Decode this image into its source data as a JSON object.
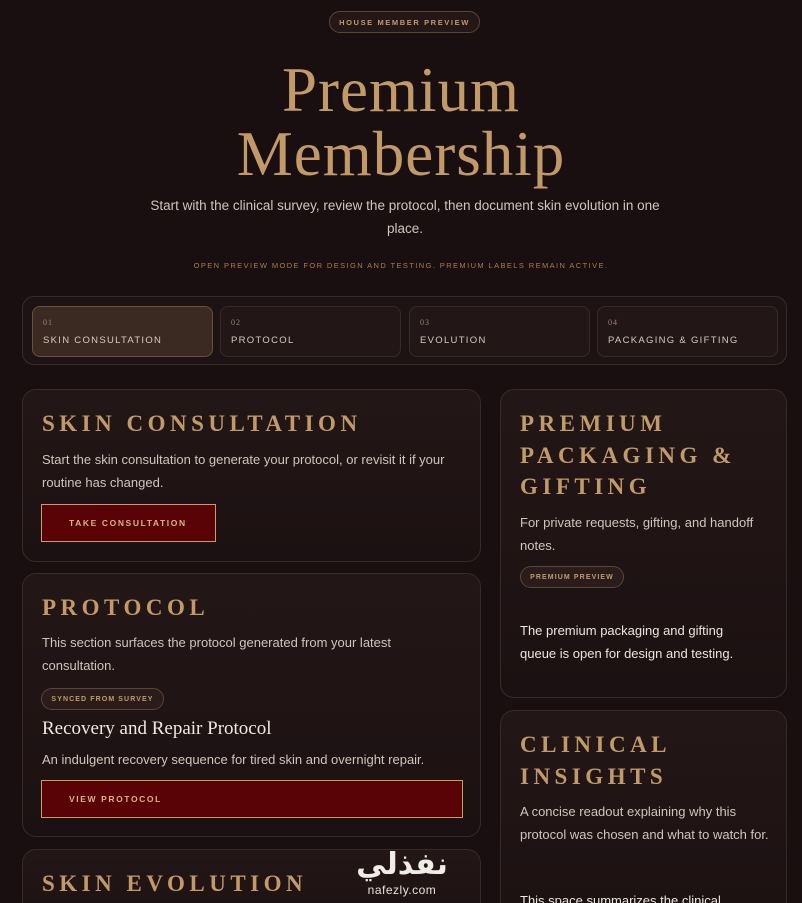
{
  "hero": {
    "badge": "HOUSE MEMBER PREVIEW",
    "title_line1": "Premium",
    "title_line2": "Membership",
    "subtitle": "Start with the clinical survey, review the protocol, then document skin evolution in one place.",
    "note": "OPEN PREVIEW MODE FOR DESIGN AND TESTING. PREMIUM LABELS REMAIN ACTIVE."
  },
  "steps": [
    {
      "num": "01",
      "label": "SKIN CONSULTATION",
      "active": true
    },
    {
      "num": "02",
      "label": "PROTOCOL",
      "active": false
    },
    {
      "num": "03",
      "label": "EVOLUTION",
      "active": false
    },
    {
      "num": "04",
      "label": "PACKAGING & GIFTING",
      "active": false
    }
  ],
  "consultation": {
    "title": "SKIN CONSULTATION",
    "body": "Start the skin consultation to generate your protocol, or revisit it if your routine has changed.",
    "button": "TAKE CONSULTATION"
  },
  "protocol": {
    "title": "PROTOCOL",
    "body": "This section surfaces the protocol generated from your latest consultation.",
    "tag": "SYNCED FROM SURVEY",
    "protocol_name": "Recovery and Repair Protocol",
    "protocol_desc": "An indulgent recovery sequence for tired skin and overnight repair.",
    "button": "VIEW PROTOCOL"
  },
  "evolution": {
    "title": "SKIN EVOLUTION"
  },
  "packaging": {
    "title_line1": "PREMIUM",
    "title_line2": "PACKAGING &",
    "title_line3": "GIFTING",
    "body": "For private requests, gifting, and handoff notes.",
    "tag": "PREMIUM PREVIEW",
    "status": "The premium packaging and gifting queue is open for design and testing."
  },
  "insights": {
    "title_line1": "CLINICAL",
    "title_line2": "INSIGHTS",
    "body": "A concise readout explaining why this protocol was chosen and what to watch for.",
    "extra": "This space summarizes the clinical"
  },
  "watermark": {
    "arabic": "نفذلي",
    "latin": "nafezly.com"
  }
}
